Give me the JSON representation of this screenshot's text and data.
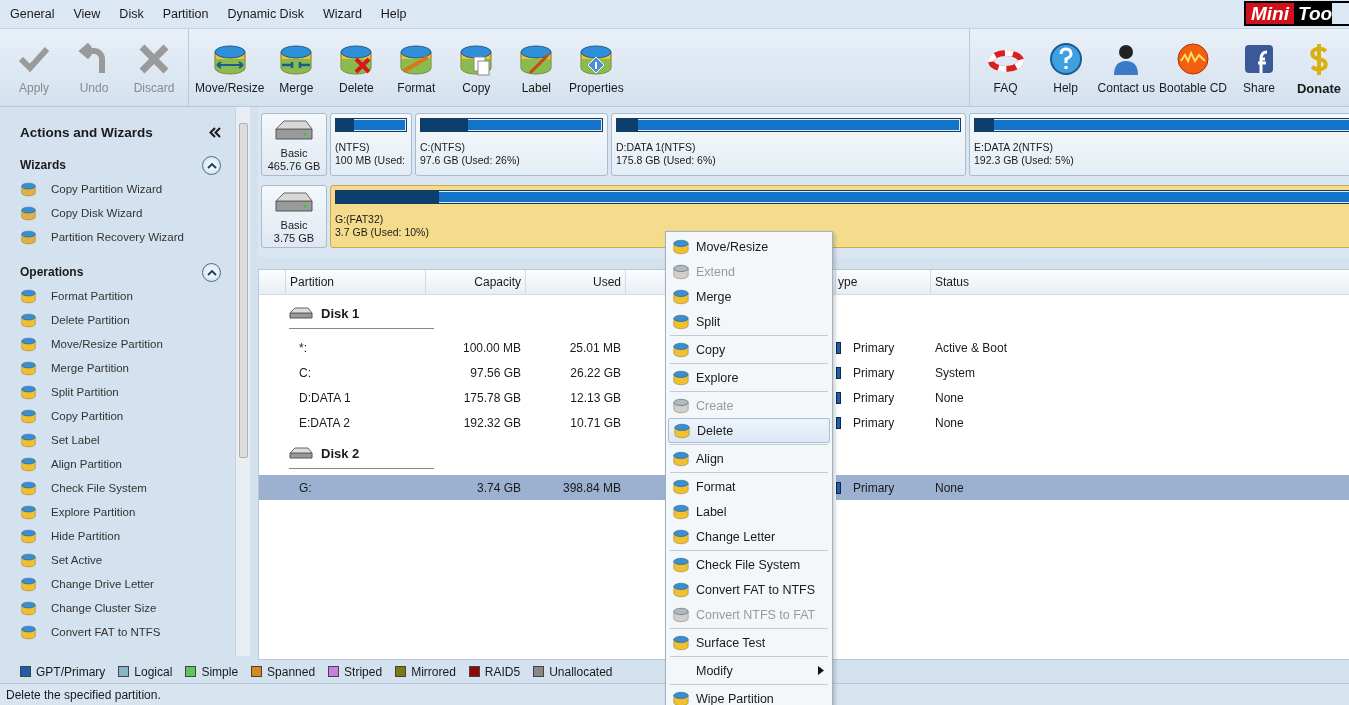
{
  "menu_bar": [
    "General",
    "View",
    "Disk",
    "Partition",
    "Dynamic Disk",
    "Wizard",
    "Help"
  ],
  "logo": {
    "text_1": "Mini",
    "text_2": "Too"
  },
  "toolbar": {
    "groups": [
      [
        {
          "label": "Apply",
          "disabled": true,
          "emphasis": false
        },
        {
          "label": "Undo",
          "disabled": true,
          "emphasis": false
        },
        {
          "label": "Discard",
          "disabled": true,
          "emphasis": false
        }
      ],
      [
        {
          "label": "Move/Resize",
          "disabled": false,
          "emphasis": false
        },
        {
          "label": "Merge",
          "disabled": false,
          "emphasis": false
        },
        {
          "label": "Delete",
          "disabled": false,
          "emphasis": false
        },
        {
          "label": "Format",
          "disabled": false,
          "emphasis": false
        },
        {
          "label": "Copy",
          "disabled": false,
          "emphasis": false
        },
        {
          "label": "Label",
          "disabled": false,
          "emphasis": false
        },
        {
          "label": "Properties",
          "disabled": false,
          "emphasis": false
        }
      ],
      [
        {
          "label": "FAQ",
          "disabled": false,
          "emphasis": false
        },
        {
          "label": "Help",
          "disabled": false,
          "emphasis": false
        },
        {
          "label": "Contact us",
          "disabled": false,
          "emphasis": false
        },
        {
          "label": "Bootable CD",
          "disabled": false,
          "emphasis": false
        },
        {
          "label": "Share",
          "disabled": false,
          "emphasis": false
        },
        {
          "label": "Donate",
          "disabled": false,
          "emphasis": true
        }
      ]
    ]
  },
  "sidebar": {
    "title": "Actions and Wizards",
    "sections": [
      {
        "title": "Wizards",
        "expanded": true,
        "items": [
          "Copy Partition Wizard",
          "Copy Disk Wizard",
          "Partition Recovery Wizard"
        ]
      },
      {
        "title": "Operations",
        "expanded": true,
        "items": [
          "Format Partition",
          "Delete Partition",
          "Move/Resize Partition",
          "Merge Partition",
          "Split Partition",
          "Copy Partition",
          "Set Label",
          "Align Partition",
          "Check File System",
          "Explore Partition",
          "Hide Partition",
          "Set Active",
          "Change Drive Letter",
          "Change Cluster Size",
          "Convert FAT to NTFS"
        ]
      }
    ]
  },
  "disk_map": [
    {
      "label": "Basic",
      "size": "465.76 GB",
      "partitions": [
        {
          "name": "(NTFS)",
          "detail": "100 MB (Used:",
          "level": 0.25,
          "selected": false
        },
        {
          "name": "C:(NTFS)",
          "detail": "97.6 GB (Used: 26%)",
          "level": 0.26,
          "selected": false
        },
        {
          "name": "D:DATA 1(NTFS)",
          "detail": "175.8 GB (Used: 6%)",
          "level": 0.06,
          "selected": false
        },
        {
          "name": "E:DATA 2(NTFS)",
          "detail": "192.3 GB (Used: 5%)",
          "level": 0.05,
          "selected": false
        }
      ]
    },
    {
      "label": "Basic",
      "size": "3.75 GB",
      "partitions": [
        {
          "name": "G:(FAT32)",
          "detail": "3.7 GB (Used: 10%)",
          "level": 0.1,
          "selected": true
        }
      ]
    }
  ],
  "table": {
    "columns": [
      "Partition",
      "Capacity",
      "Used",
      "ype",
      "Status"
    ],
    "groups": [
      {
        "disk": "Disk 1",
        "rows": [
          {
            "partition": "*:",
            "capacity": "100.00 MB",
            "used": "25.01 MB",
            "type": "Primary",
            "status": "Active & Boot",
            "selected": false
          },
          {
            "partition": "C:",
            "capacity": "97.56 GB",
            "used": "26.22 GB",
            "type": "Primary",
            "status": "System",
            "selected": false
          },
          {
            "partition": "D:DATA 1",
            "capacity": "175.78 GB",
            "used": "12.13 GB",
            "type": "Primary",
            "status": "None",
            "selected": false
          },
          {
            "partition": "E:DATA 2",
            "capacity": "192.32 GB",
            "used": "10.71 GB",
            "type": "Primary",
            "status": "None",
            "selected": false
          }
        ]
      },
      {
        "disk": "Disk 2",
        "rows": [
          {
            "partition": "G:",
            "capacity": "3.74 GB",
            "used": "398.84 MB",
            "type": "Primary",
            "status": "None",
            "selected": true
          }
        ]
      }
    ]
  },
  "context_menu": [
    {
      "label": "Move/Resize",
      "kind": "item",
      "disabled": false,
      "selected": false,
      "separator_after": false
    },
    {
      "label": "Extend",
      "kind": "item",
      "disabled": true,
      "selected": false,
      "separator_after": false
    },
    {
      "label": "Merge",
      "kind": "item",
      "disabled": false,
      "selected": false,
      "separator_after": false
    },
    {
      "label": "Split",
      "kind": "item",
      "disabled": false,
      "selected": false,
      "separator_after": true
    },
    {
      "label": "Copy",
      "kind": "item",
      "disabled": false,
      "selected": false,
      "separator_after": true
    },
    {
      "label": "Explore",
      "kind": "item",
      "disabled": false,
      "selected": false,
      "separator_after": true
    },
    {
      "label": "Create",
      "kind": "item",
      "disabled": true,
      "selected": false,
      "separator_after": false
    },
    {
      "label": "Delete",
      "kind": "item",
      "disabled": false,
      "selected": true,
      "separator_after": true
    },
    {
      "label": "Align",
      "kind": "item",
      "disabled": false,
      "selected": false,
      "separator_after": true
    },
    {
      "label": "Format",
      "kind": "item",
      "disabled": false,
      "selected": false,
      "separator_after": false
    },
    {
      "label": "Label",
      "kind": "item",
      "disabled": false,
      "selected": false,
      "separator_after": false
    },
    {
      "label": "Change Letter",
      "kind": "item",
      "disabled": false,
      "selected": false,
      "separator_after": true
    },
    {
      "label": "Check File System",
      "kind": "item",
      "disabled": false,
      "selected": false,
      "separator_after": false
    },
    {
      "label": "Convert FAT to NTFS",
      "kind": "item",
      "disabled": false,
      "selected": false,
      "separator_after": false
    },
    {
      "label": "Convert NTFS to FAT",
      "kind": "item",
      "disabled": true,
      "selected": false,
      "separator_after": true
    },
    {
      "label": "Surface Test",
      "kind": "item",
      "disabled": false,
      "selected": false,
      "separator_after": true
    },
    {
      "label": "Modify",
      "kind": "submenu",
      "disabled": false,
      "selected": false,
      "separator_after": true
    },
    {
      "label": "Wipe Partition",
      "kind": "item",
      "disabled": false,
      "selected": false,
      "separator_after": false
    }
  ],
  "legend": [
    {
      "label": "GPT/Primary",
      "color": "#1f5fa8"
    },
    {
      "label": "Logical",
      "color": "#88b4c8"
    },
    {
      "label": "Simple",
      "color": "#5cc85c"
    },
    {
      "label": "Spanned",
      "color": "#d8881c"
    },
    {
      "label": "Striped",
      "color": "#c87fe0"
    },
    {
      "label": "Mirrored",
      "color": "#7a7a10"
    },
    {
      "label": "RAID5",
      "color": "#8b0a0a"
    },
    {
      "label": "Unallocated",
      "color": "#888888"
    }
  ],
  "status_bar": "Delete the specified partition."
}
